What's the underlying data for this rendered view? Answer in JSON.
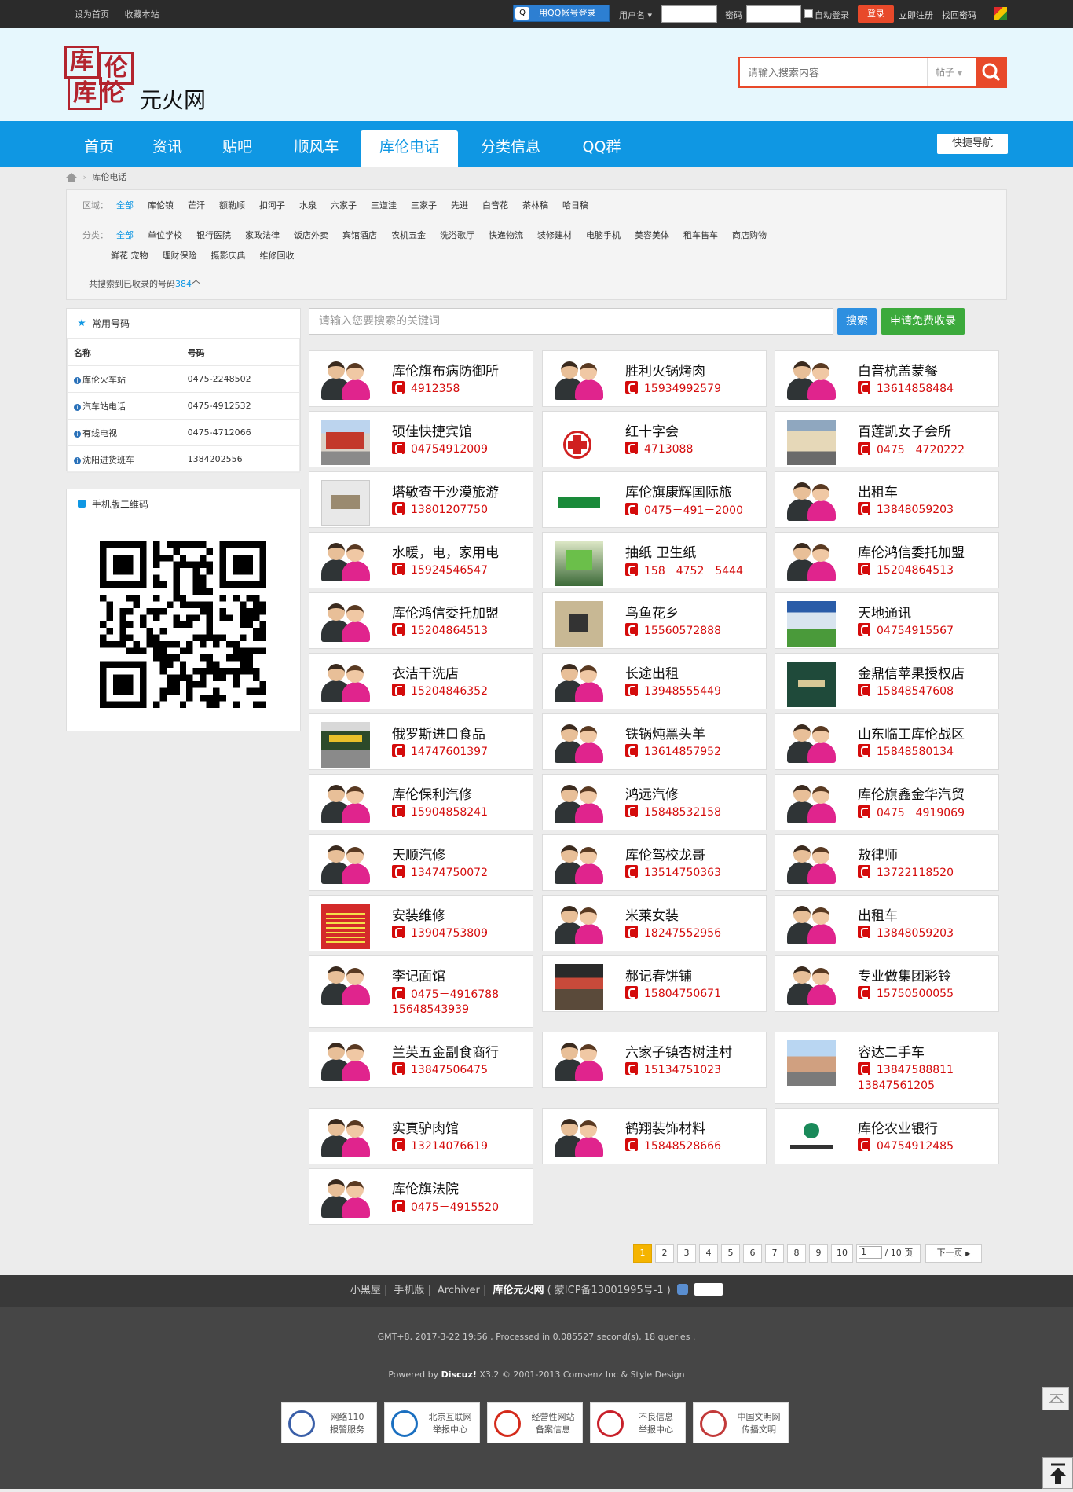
{
  "topbar": {
    "set_home": "设为首页",
    "bookmark": "收藏本站",
    "qq_login": "用QQ帐号登录",
    "username_label": "用户名",
    "password_label": "密码",
    "auto_login": "自动登录",
    "login": "登录",
    "register": "立即注册",
    "find_password": "找回密码"
  },
  "header": {
    "site_name": "元火网",
    "search_placeholder": "请输入搜索内容",
    "search_type": "帖子"
  },
  "nav": {
    "items": [
      "首页",
      "资讯",
      "贴吧",
      "顺风车",
      "库伦电话",
      "分类信息",
      "QQ群"
    ],
    "active": "库伦电话",
    "quick_nav": "快捷导航"
  },
  "breadcrumb": "库伦电话",
  "filter": {
    "area_label": "区域：",
    "areas": [
      "全部",
      "库伦镇",
      "芒汗",
      "额勒顺",
      "扣河子",
      "水泉",
      "六家子",
      "三道洼",
      "三家子",
      "先进",
      "白音花",
      "茶林稿",
      "哈日稿"
    ],
    "category_label": "分类：",
    "categories": [
      "全部",
      "单位学校",
      "银行医院",
      "家政法律",
      "饭店外卖",
      "宾馆酒店",
      "农机五金",
      "洗浴歌厅",
      "快递物流",
      "装修建材",
      "电脑手机",
      "美容美体",
      "租车售车",
      "商店购物",
      "鲜花 宠物",
      "理财保险",
      "摄影庆典",
      "维修回收"
    ],
    "count_prefix": "共搜索到已收录的号码",
    "count": "384",
    "count_suffix": "个"
  },
  "sidebar": {
    "common_title": "常用号码",
    "col_name": "名称",
    "col_number": "号码",
    "rows": [
      {
        "name": "库伦火车站",
        "number": "0475-2248502"
      },
      {
        "name": "汽车站电话",
        "number": "0475-4912532"
      },
      {
        "name": "有线电视",
        "number": "0475-4712066"
      },
      {
        "name": "沈阳进货班车",
        "number": "1384202556"
      }
    ],
    "qr_title": "手机版二维码"
  },
  "main": {
    "keyword_placeholder": "请输入您要搜索的关键词",
    "search_btn": "搜索",
    "apply_btn": "申请免费收录",
    "cards": [
      {
        "name": "库伦旗布病防御所",
        "phone": "4912358"
      },
      {
        "name": "胜利火锅烤肉",
        "phone": "15934992579"
      },
      {
        "name": "白音杭盖蒙餐",
        "phone": "13614858484"
      },
      {
        "name": "硕佳快捷宾馆",
        "phone": "04754912009"
      },
      {
        "name": "红十字会",
        "phone": "4713088"
      },
      {
        "name": "百莲凯女子会所",
        "phone": "0475－4720222"
      },
      {
        "name": "塔敏查干沙漠旅游",
        "phone": "13801207750"
      },
      {
        "name": "库伦旗康辉国际旅",
        "phone": "0475－491－2000"
      },
      {
        "name": "出租车",
        "phone": "13848059203"
      },
      {
        "name": "水暖，电，家用电",
        "phone": "15924546547"
      },
      {
        "name": "抽纸 卫生纸",
        "phone": "158－4752－5444"
      },
      {
        "name": "库伦鸿信委托加盟",
        "phone": "15204864513"
      },
      {
        "name": "库伦鸿信委托加盟",
        "phone": "15204864513"
      },
      {
        "name": "鸟鱼花乡",
        "phone": "15560572888"
      },
      {
        "name": "天地通讯",
        "phone": "04754915567"
      },
      {
        "name": "衣洁干洗店",
        "phone": "15204846352"
      },
      {
        "name": "长途出租",
        "phone": "13948555449"
      },
      {
        "name": "金鼎信苹果授权店",
        "phone": "15848547608"
      },
      {
        "name": "俄罗斯进口食品",
        "phone": "14747601397"
      },
      {
        "name": "铁锅炖黑头羊",
        "phone": "13614857952"
      },
      {
        "name": "山东临工库伦战区",
        "phone": "15848580134"
      },
      {
        "name": "库伦保利汽修",
        "phone": "15904858241"
      },
      {
        "name": "鸿远汽修",
        "phone": "15848532158"
      },
      {
        "name": "库伦旗鑫金华汽贸",
        "phone": "0475－4919069"
      },
      {
        "name": "天顺汽修",
        "phone": "13474750072"
      },
      {
        "name": "库伦驾校龙哥",
        "phone": "13514750363"
      },
      {
        "name": "敖律师",
        "phone": "13722118520"
      },
      {
        "name": "安装维修",
        "phone": "13904753809"
      },
      {
        "name": "米莱女装",
        "phone": "18247552956"
      },
      {
        "name": "出租车",
        "phone": "13848059203"
      },
      {
        "name": "李记面馆",
        "phone": "0475－4916788",
        "phone2": "15648543939"
      },
      {
        "name": "郝记春饼铺",
        "phone": "15804750671"
      },
      {
        "name": "专业做集团彩铃",
        "phone": "15750500055"
      },
      {
        "name": "兰英五金副食商行",
        "phone": "13847506475"
      },
      {
        "name": "六家子镇杏树洼村",
        "phone": "15134751023"
      },
      {
        "name": "容达二手车",
        "phone": "13847588811",
        "phone2": "13847561205"
      },
      {
        "name": "实真驴肉馆",
        "phone": "13214076619"
      },
      {
        "name": "鹤翔装饰材料",
        "phone": "15848528666"
      },
      {
        "name": "库伦农业银行",
        "phone": "04754912485"
      },
      {
        "name": "库伦旗法院",
        "phone": "0475－4915520"
      }
    ]
  },
  "pager": {
    "pages": [
      "1",
      "2",
      "3",
      "4",
      "5",
      "6",
      "7",
      "8",
      "9",
      "10"
    ],
    "current": "1",
    "input": "1",
    "total": "/ 10 页",
    "next": "下一页"
  },
  "footer": {
    "links": [
      "小黑屋",
      "手机版",
      "Archiver"
    ],
    "site": "库伦元火网",
    "icp": "( 蒙ICP备13001995号-1 )",
    "line1": "GMT+8, 2017-3-22 19:56 , Processed in 0.085527 second(s), 18 queries .",
    "powered_prefix": "Powered by ",
    "powered_brand": "Discuz!",
    "powered_suffix": " X3.2 © 2001-2013 Comsenz Inc & Style Design",
    "badges": [
      {
        "l1": "网络110",
        "l2": "报警服务",
        "color": "#3a5fa8"
      },
      {
        "l1": "北京互联网",
        "l2": "举报中心",
        "color": "#1a6fc0"
      },
      {
        "l1": "经营性网站",
        "l2": "备案信息",
        "color": "#d42a1a"
      },
      {
        "l1": "不良信息",
        "l2": "举报中心",
        "color": "#c8202a"
      },
      {
        "l1": "中国文明网",
        "l2": "传播文明",
        "color": "#c23a3a"
      }
    ]
  }
}
